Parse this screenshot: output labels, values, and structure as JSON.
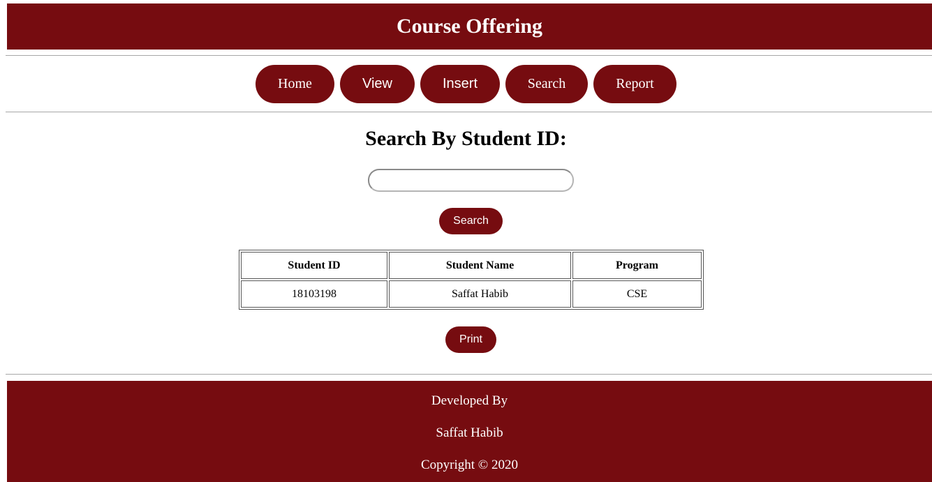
{
  "header": {
    "title": "Course Offering"
  },
  "nav": {
    "items": [
      "Home",
      "View",
      "Insert",
      "Search",
      "Report"
    ]
  },
  "search": {
    "heading": "Search By Student ID:",
    "input_value": "",
    "button_label": "Search"
  },
  "table": {
    "headers": [
      "Student ID",
      "Student Name",
      "Program"
    ],
    "rows": [
      [
        "18103198",
        "Saffat Habib",
        "CSE"
      ]
    ]
  },
  "print_label": "Print",
  "footer": {
    "line1": "Developed By",
    "line2": "Saffat Habib",
    "line3": "Copyright © 2020"
  },
  "colors": {
    "brand": "#760c10",
    "text_on_brand": "#ffffff"
  }
}
